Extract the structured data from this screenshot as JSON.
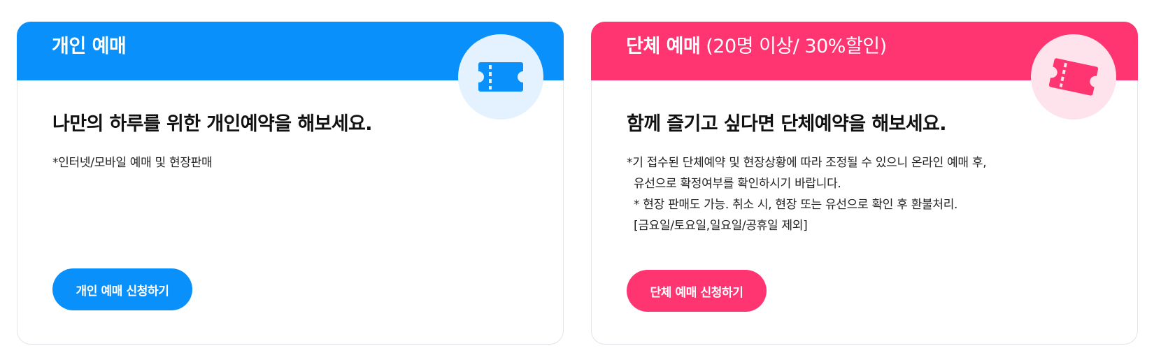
{
  "colors": {
    "individual_accent": "#0a90fa",
    "individual_badge_bg": "#e3f2fe",
    "group_accent": "#ff3572",
    "group_badge_bg": "#ffe3ec"
  },
  "individual": {
    "title": "개인 예매",
    "icon": "ticket-icon",
    "headline": "나만의 하루를 위한 개인예약을 해보세요.",
    "notes": [
      "*인터넷/모바일 예매 및 현장판매"
    ],
    "button_label": "개인 예매 신청하기"
  },
  "group": {
    "title": "단체 예매",
    "title_detail": "(20명 이상/ 30%할인)",
    "icon": "ticket-icon",
    "headline": "함께 즐기고 싶다면 단체예약을 해보세요.",
    "notes": [
      "*기 접수된 단체예약 및 현장상황에 따라 조정될 수 있으니 온라인 예매 후,",
      "유선으로 확정여부를 확인하시기 바랍니다.",
      "* 현장 판매도 가능. 취소 시, 현장 또는 유선으로 확인 후 환불처리.",
      "[금요일/토요일,일요일/공휴일 제외]"
    ],
    "button_label": "단체 예매 신청하기"
  }
}
